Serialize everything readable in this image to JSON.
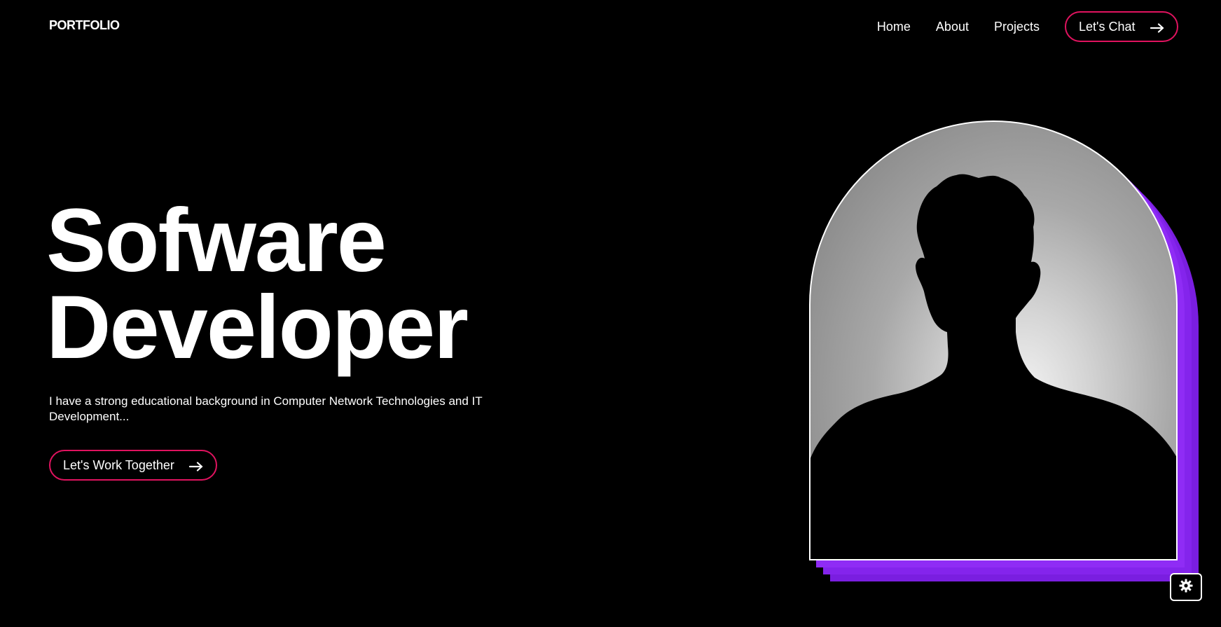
{
  "header": {
    "logo": "PORTFOLIO",
    "nav": [
      {
        "label": "Home"
      },
      {
        "label": "About"
      },
      {
        "label": "Projects"
      }
    ],
    "cta_label": "Let's Chat",
    "cta_icon": "arrow-right-icon"
  },
  "hero": {
    "title_line1": "Sofware",
    "title_line2": "Developer",
    "description": "I have a strong educational background in Computer Network Technologies and IT Development...",
    "button_label": "Let's Work Together",
    "button_icon": "arrow-right-icon"
  },
  "portrait": {
    "alt": "silhouette-portrait"
  },
  "settings": {
    "icon": "gear-icon"
  },
  "colors": {
    "background": "#000000",
    "accent_border": "#e0135f",
    "purple_shadow": "#8f2cf5",
    "text": "#ffffff"
  }
}
